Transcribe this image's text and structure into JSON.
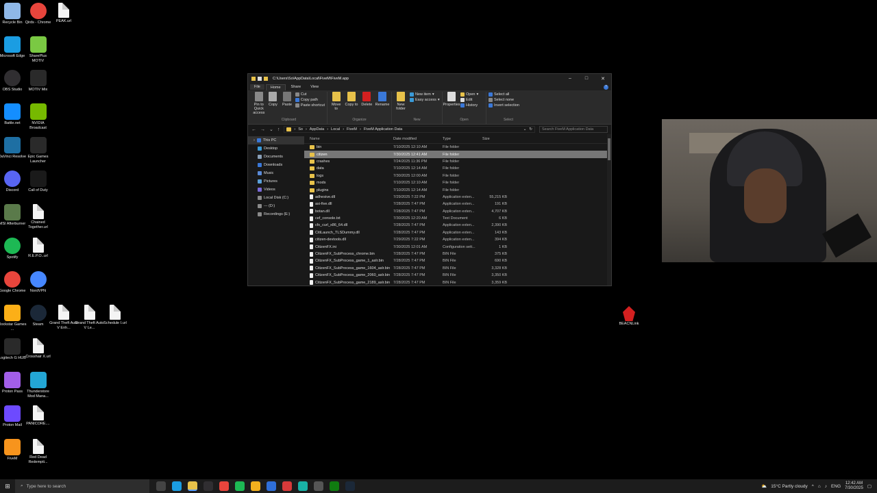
{
  "desktop_icons": [
    {
      "id": "recycle-bin",
      "label": "Recycle Bin",
      "icon": "recycle-bin-icon",
      "color": "#8fb8e8"
    },
    {
      "id": "qirds-chrome",
      "label": "Qirds - Chrome",
      "icon": "chrome-icon",
      "color": "#e8453c"
    },
    {
      "id": "peak-url",
      "label": "PEAK.url",
      "icon": "file-icon",
      "color": "#f4f4f4"
    },
    {
      "id": "microsoft-edge",
      "label": "Microsoft Edge",
      "icon": "edge-icon",
      "color": "#1b9de2"
    },
    {
      "id": "shareplus-motiv",
      "label": "SharePlus MOTIV",
      "icon": "shareplus-icon",
      "color": "#7ac943"
    },
    {
      "id": "obs-studio",
      "label": "OBS Studio",
      "icon": "obs-icon",
      "color": "#302e31"
    },
    {
      "id": "motiv-mix",
      "label": "MOTIV Mix",
      "icon": "motiv-mix-icon",
      "color": "#2a2a2a"
    },
    {
      "id": "battle-net",
      "label": "Battle.net",
      "icon": "battlenet-icon",
      "color": "#148eff"
    },
    {
      "id": "nvidia-broadcast",
      "label": "NVIDIA Broadcast",
      "icon": "nvidia-icon",
      "color": "#76b900"
    },
    {
      "id": "davinci-resolve",
      "label": "DaVinci Resolve",
      "icon": "davinci-icon",
      "color": "#1e6fa3"
    },
    {
      "id": "epic-games",
      "label": "Epic Games Launcher",
      "icon": "epic-icon",
      "color": "#2a2a2a"
    },
    {
      "id": "discord",
      "label": "Discord",
      "icon": "discord-icon",
      "color": "#5865f2"
    },
    {
      "id": "call-of-duty",
      "label": "Call of Duty",
      "icon": "cod-icon",
      "color": "#1a1a1a"
    },
    {
      "id": "msi-afterburner",
      "label": "MSI Afterburner",
      "icon": "afterburner-icon",
      "color": "#5a7a4a"
    },
    {
      "id": "chained-together",
      "label": "Chained Together.url",
      "icon": "file-icon",
      "color": "#f4f4f4"
    },
    {
      "id": "spotify",
      "label": "Spotify",
      "icon": "spotify-icon",
      "color": "#1db954"
    },
    {
      "id": "repo-url",
      "label": "R.E.P.O..url",
      "icon": "file-icon",
      "color": "#f4f4f4"
    },
    {
      "id": "google-chrome",
      "label": "Google Chrome",
      "icon": "chrome-icon",
      "color": "#e8453c"
    },
    {
      "id": "nordvpn",
      "label": "NordVPN",
      "icon": "nordvpn-icon",
      "color": "#4687ff"
    },
    {
      "id": "rockstar-games",
      "label": "Rockstar Games ...",
      "icon": "rockstar-icon",
      "color": "#fcaf17"
    },
    {
      "id": "steam",
      "label": "Steam",
      "icon": "steam-icon",
      "color": "#1b2838"
    },
    {
      "id": "gta-enh",
      "label": "Grand Theft Auto V Enh...",
      "icon": "file-icon",
      "color": "#f4f4f4"
    },
    {
      "id": "gta-le",
      "label": "Grand Theft Auto V Le...",
      "icon": "file-icon",
      "color": "#f4f4f4"
    },
    {
      "id": "schedule-url",
      "label": "Schedule I.url",
      "icon": "file-icon",
      "color": "#f4f4f4"
    },
    {
      "id": "logitech-g-hub",
      "label": "Logitech G HUB",
      "icon": "logitech-icon",
      "color": "#2a2a2a"
    },
    {
      "id": "crosshair-x",
      "label": "Crosshair X.url",
      "icon": "file-icon",
      "color": "#f4f4f4"
    },
    {
      "id": "proton-pass",
      "label": "Proton Pass",
      "icon": "proton-pass-icon",
      "color": "#a25ee8"
    },
    {
      "id": "thunderstore",
      "label": "Thunderstore Mod Mana...",
      "icon": "thunderstore-icon",
      "color": "#23a6d5"
    },
    {
      "id": "proton-mail",
      "label": "Proton Mail",
      "icon": "proton-mail-icon",
      "color": "#6d4aff"
    },
    {
      "id": "panicore-url",
      "label": "PANICORE....",
      "icon": "file-icon",
      "color": "#f4f4f4"
    },
    {
      "id": "fivem",
      "label": "FiveM",
      "icon": "fivem-icon",
      "color": "#f7941d"
    },
    {
      "id": "red-dead",
      "label": "Red Dead Redempti...",
      "icon": "file-icon",
      "color": "#f4f4f4"
    }
  ],
  "explorer": {
    "title": "C:\\Users\\So\\AppData\\Local\\FiveM\\FiveM.app",
    "tabs": [
      "File",
      "Home",
      "Share",
      "View"
    ],
    "active_tab": "Home",
    "ribbon": {
      "clipboard": {
        "label": "Clipboard",
        "pin": "Pin to Quick access",
        "copy": "Copy",
        "paste": "Paste",
        "cut": "Cut",
        "copy_path": "Copy path",
        "paste_shortcut": "Paste shortcut"
      },
      "organize": {
        "label": "Organize",
        "move_to": "Move to",
        "copy_to": "Copy to",
        "delete": "Delete",
        "rename": "Rename"
      },
      "new": {
        "label": "New",
        "new_folder": "New folder",
        "new_item": "New item",
        "easy_access": "Easy access"
      },
      "open": {
        "label": "Open",
        "properties": "Properties",
        "open": "Open",
        "edit": "Edit",
        "history": "History"
      },
      "select": {
        "label": "Select",
        "select_all": "Select all",
        "select_none": "Select none",
        "invert": "Invert selection"
      }
    },
    "address": {
      "crumbs": [
        "So",
        "AppData",
        "Local",
        "FiveM",
        "FiveM Application Data"
      ],
      "search_placeholder": "Search FiveM Application Data"
    },
    "nav_pane": [
      {
        "label": "This PC",
        "icon": "pc-icon",
        "color": "#3a78d8",
        "selected": true
      },
      {
        "label": "Desktop",
        "icon": "desktop-icon",
        "color": "#3a9ad8"
      },
      {
        "label": "Documents",
        "icon": "documents-icon",
        "color": "#8aa0b8"
      },
      {
        "label": "Downloads",
        "icon": "downloads-icon",
        "color": "#3a78d8"
      },
      {
        "label": "Music",
        "icon": "music-icon",
        "color": "#5a8ad8"
      },
      {
        "label": "Pictures",
        "icon": "pictures-icon",
        "color": "#5aa0d8"
      },
      {
        "label": "Videos",
        "icon": "videos-icon",
        "color": "#7a6ad8"
      },
      {
        "label": "Local Disk (C:)",
        "icon": "drive-icon",
        "color": "#8a8a8a"
      },
      {
        "label": "--- (D:)",
        "icon": "drive-icon",
        "color": "#8a8a8a"
      },
      {
        "label": "Recordings (E:)",
        "icon": "drive-icon",
        "color": "#8a8a8a"
      }
    ],
    "columns": [
      "Name",
      "Date modified",
      "Type",
      "Size"
    ],
    "files": [
      {
        "name": "bin",
        "date": "7/10/2025 12:10 AM",
        "type": "File folder",
        "size": "",
        "kind": "folder"
      },
      {
        "name": "citizen",
        "date": "7/30/2025 12:41 AM",
        "type": "File folder",
        "size": "",
        "kind": "folder",
        "selected": true
      },
      {
        "name": "crashes",
        "date": "7/24/2025 11:36 PM",
        "type": "File folder",
        "size": "",
        "kind": "folder"
      },
      {
        "name": "data",
        "date": "7/10/2025 12:14 AM",
        "type": "File folder",
        "size": "",
        "kind": "folder"
      },
      {
        "name": "logs",
        "date": "7/30/2025 12:00 AM",
        "type": "File folder",
        "size": "",
        "kind": "folder"
      },
      {
        "name": "mods",
        "date": "7/10/2025 12:10 AM",
        "type": "File folder",
        "size": "",
        "kind": "folder"
      },
      {
        "name": "plugins",
        "date": "7/10/2025 12:14 AM",
        "type": "File folder",
        "size": "",
        "kind": "folder"
      },
      {
        "name": "adhesive.dll",
        "date": "7/29/2025 7:22 PM",
        "type": "Application exten...",
        "size": "55,215 KB",
        "kind": "doc"
      },
      {
        "name": "asi-five.dll",
        "date": "7/28/2025 7:47 PM",
        "type": "Application exten...",
        "size": "191 KB",
        "kind": "doc"
      },
      {
        "name": "botan.dll",
        "date": "7/28/2025 7:47 PM",
        "type": "Application exten...",
        "size": "4,707 KB",
        "kind": "doc"
      },
      {
        "name": "cef_console.txt",
        "date": "7/30/2025 12:20 AM",
        "type": "Text Document",
        "size": "6 KB",
        "kind": "doc"
      },
      {
        "name": "cfx_curl_x86_64.dll",
        "date": "7/28/2025 7:47 PM",
        "type": "Application exten...",
        "size": "2,390 KB",
        "kind": "doc"
      },
      {
        "name": "CitiLaunch_TLSDummy.dll",
        "date": "7/28/2025 7:47 PM",
        "type": "Application exten...",
        "size": "143 KB",
        "kind": "doc"
      },
      {
        "name": "citizen-devtools.dll",
        "date": "7/29/2025 7:22 PM",
        "type": "Application exten...",
        "size": "394 KB",
        "kind": "doc"
      },
      {
        "name": "CitizenFX.ini",
        "date": "7/30/2025 12:01 AM",
        "type": "Configuration sett...",
        "size": "1 KB",
        "kind": "doc"
      },
      {
        "name": "CitizenFX_SubProcess_chrome.bin",
        "date": "7/28/2025 7:47 PM",
        "type": "BIN File",
        "size": "375 KB",
        "kind": "doc"
      },
      {
        "name": "CitizenFX_SubProcess_game_1_aslr.bin",
        "date": "7/28/2025 7:47 PM",
        "type": "BIN File",
        "size": "690 KB",
        "kind": "doc"
      },
      {
        "name": "CitizenFX_SubProcess_game_1604_aslr.bin",
        "date": "7/28/2025 7:47 PM",
        "type": "BIN File",
        "size": "3,328 KB",
        "kind": "doc"
      },
      {
        "name": "CitizenFX_SubProcess_game_2060_aslr.bin",
        "date": "7/28/2025 7:47 PM",
        "type": "BIN File",
        "size": "3,350 KB",
        "kind": "doc"
      },
      {
        "name": "CitizenFX_SubProcess_game_2189_aslr.bin",
        "date": "7/28/2025 7:47 PM",
        "type": "BIN File",
        "size": "3,359 KB",
        "kind": "doc"
      }
    ]
  },
  "beacn": {
    "label": "BEACNLink",
    "color": "#d32020"
  },
  "taskbar": {
    "search_placeholder": "Type here to search",
    "apps": [
      {
        "name": "task-view-icon",
        "color": "#444444"
      },
      {
        "name": "edge-icon",
        "color": "#1b9de2"
      },
      {
        "name": "file-explorer-icon",
        "color": "#e8c24a",
        "active": true
      },
      {
        "name": "obs-icon",
        "color": "#302e31"
      },
      {
        "name": "chrome-icon",
        "color": "#e8453c"
      },
      {
        "name": "spotify-icon",
        "color": "#1db954"
      },
      {
        "name": "store-icon",
        "color": "#f2b01e"
      },
      {
        "name": "photos-icon",
        "color": "#2f6fd8"
      },
      {
        "name": "chrome-alt-icon",
        "color": "#d83a3a"
      },
      {
        "name": "app-icon",
        "color": "#19b1a5"
      },
      {
        "name": "capture-icon",
        "color": "#555555"
      },
      {
        "name": "xbox-icon",
        "color": "#107c10"
      },
      {
        "name": "steam-icon",
        "color": "#1b2838"
      }
    ],
    "weather": "15°C  Partly cloudy",
    "language": "ENG",
    "time": "12:42 AM",
    "date": "7/30/2025"
  }
}
